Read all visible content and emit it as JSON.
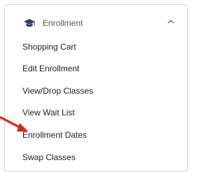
{
  "header": {
    "label": "Enrollment",
    "icon": "graduation-cap-icon",
    "toggle_icon": "chevron-up-icon"
  },
  "menu": {
    "items": [
      {
        "label": "Shopping Cart"
      },
      {
        "label": "Edit Enrollment"
      },
      {
        "label": "View/Drop Classes"
      },
      {
        "label": "View Wait List"
      },
      {
        "label": "Enrollment Dates"
      },
      {
        "label": "Swap Classes"
      }
    ]
  },
  "annotation": {
    "icon": "red-arrow-icon",
    "color": "#e01e16"
  },
  "colors": {
    "icon_navy": "#2f3f63",
    "text": "#222222",
    "header_text": "#555555",
    "border": "#d6d6d6"
  }
}
